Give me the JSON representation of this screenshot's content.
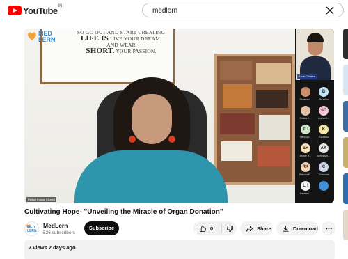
{
  "header": {
    "logo_text": "YouTube",
    "country_code": "IN",
    "search": {
      "value": "medlern",
      "placeholder": "Search"
    }
  },
  "player": {
    "poster_lines": [
      "SO GO OUT AND START CREATING",
      "LIFE IS",
      "LIVE YOUR DREAM,",
      "AND WEAR",
      "SHORT.",
      "YOUR PASSION."
    ],
    "overlay_logo": "MED LERN",
    "speaker_tag": "Pallavi Kumar (Guest)",
    "presenter_tag": "Karan Chhabra",
    "participants": [
      {
        "initials": "",
        "name": "Shubhan...",
        "color": "#c98d6e"
      },
      {
        "initials": "B",
        "name": "Bhumika",
        "color": "#bfe3f5"
      },
      {
        "initials": "",
        "name": "Shikha K...",
        "color": "#e2c0a6"
      },
      {
        "initials": "SD",
        "name": "sneha D...",
        "color": "#f6c7cf"
      },
      {
        "initials": "TU",
        "name": "Tanvi Up...",
        "color": "#cfe8c9"
      },
      {
        "initials": "K",
        "name": "Kaushiki",
        "color": "#f5e6a6"
      },
      {
        "initials": "EH",
        "name": "Esther H...",
        "color": "#f8e1b8"
      },
      {
        "initials": "AK",
        "name": "Abhinav K...",
        "color": "#e6e6e6"
      },
      {
        "initials": "RK",
        "name": "Raksha K...",
        "color": "#f3d2b0"
      },
      {
        "initials": "C",
        "name": "Chanchal",
        "color": "#cfd8ea"
      },
      {
        "initials": "LH",
        "name": "Lakshmi...",
        "color": "#f2f2f2"
      },
      {
        "initials": "",
        "name": "",
        "color": "#3f8fd6"
      }
    ]
  },
  "video": {
    "title": "Cultivating Hope- \"Unveiling the Miracle of Organ Donation\"",
    "channel": {
      "name": "MedLern",
      "subscribers": "526 subscribers",
      "avatar_text": "MED LERN"
    },
    "subscribe_label": "Subscribe",
    "likes": "0",
    "share_label": "Share",
    "download_label": "Download",
    "views_date": "7 views  2 days ago"
  },
  "colors": {
    "brand_red": "#ff0000",
    "subscribe_bg": "#0f0f0f",
    "pill_bg": "#f2f2f2",
    "shirt": "#2f95ad"
  }
}
